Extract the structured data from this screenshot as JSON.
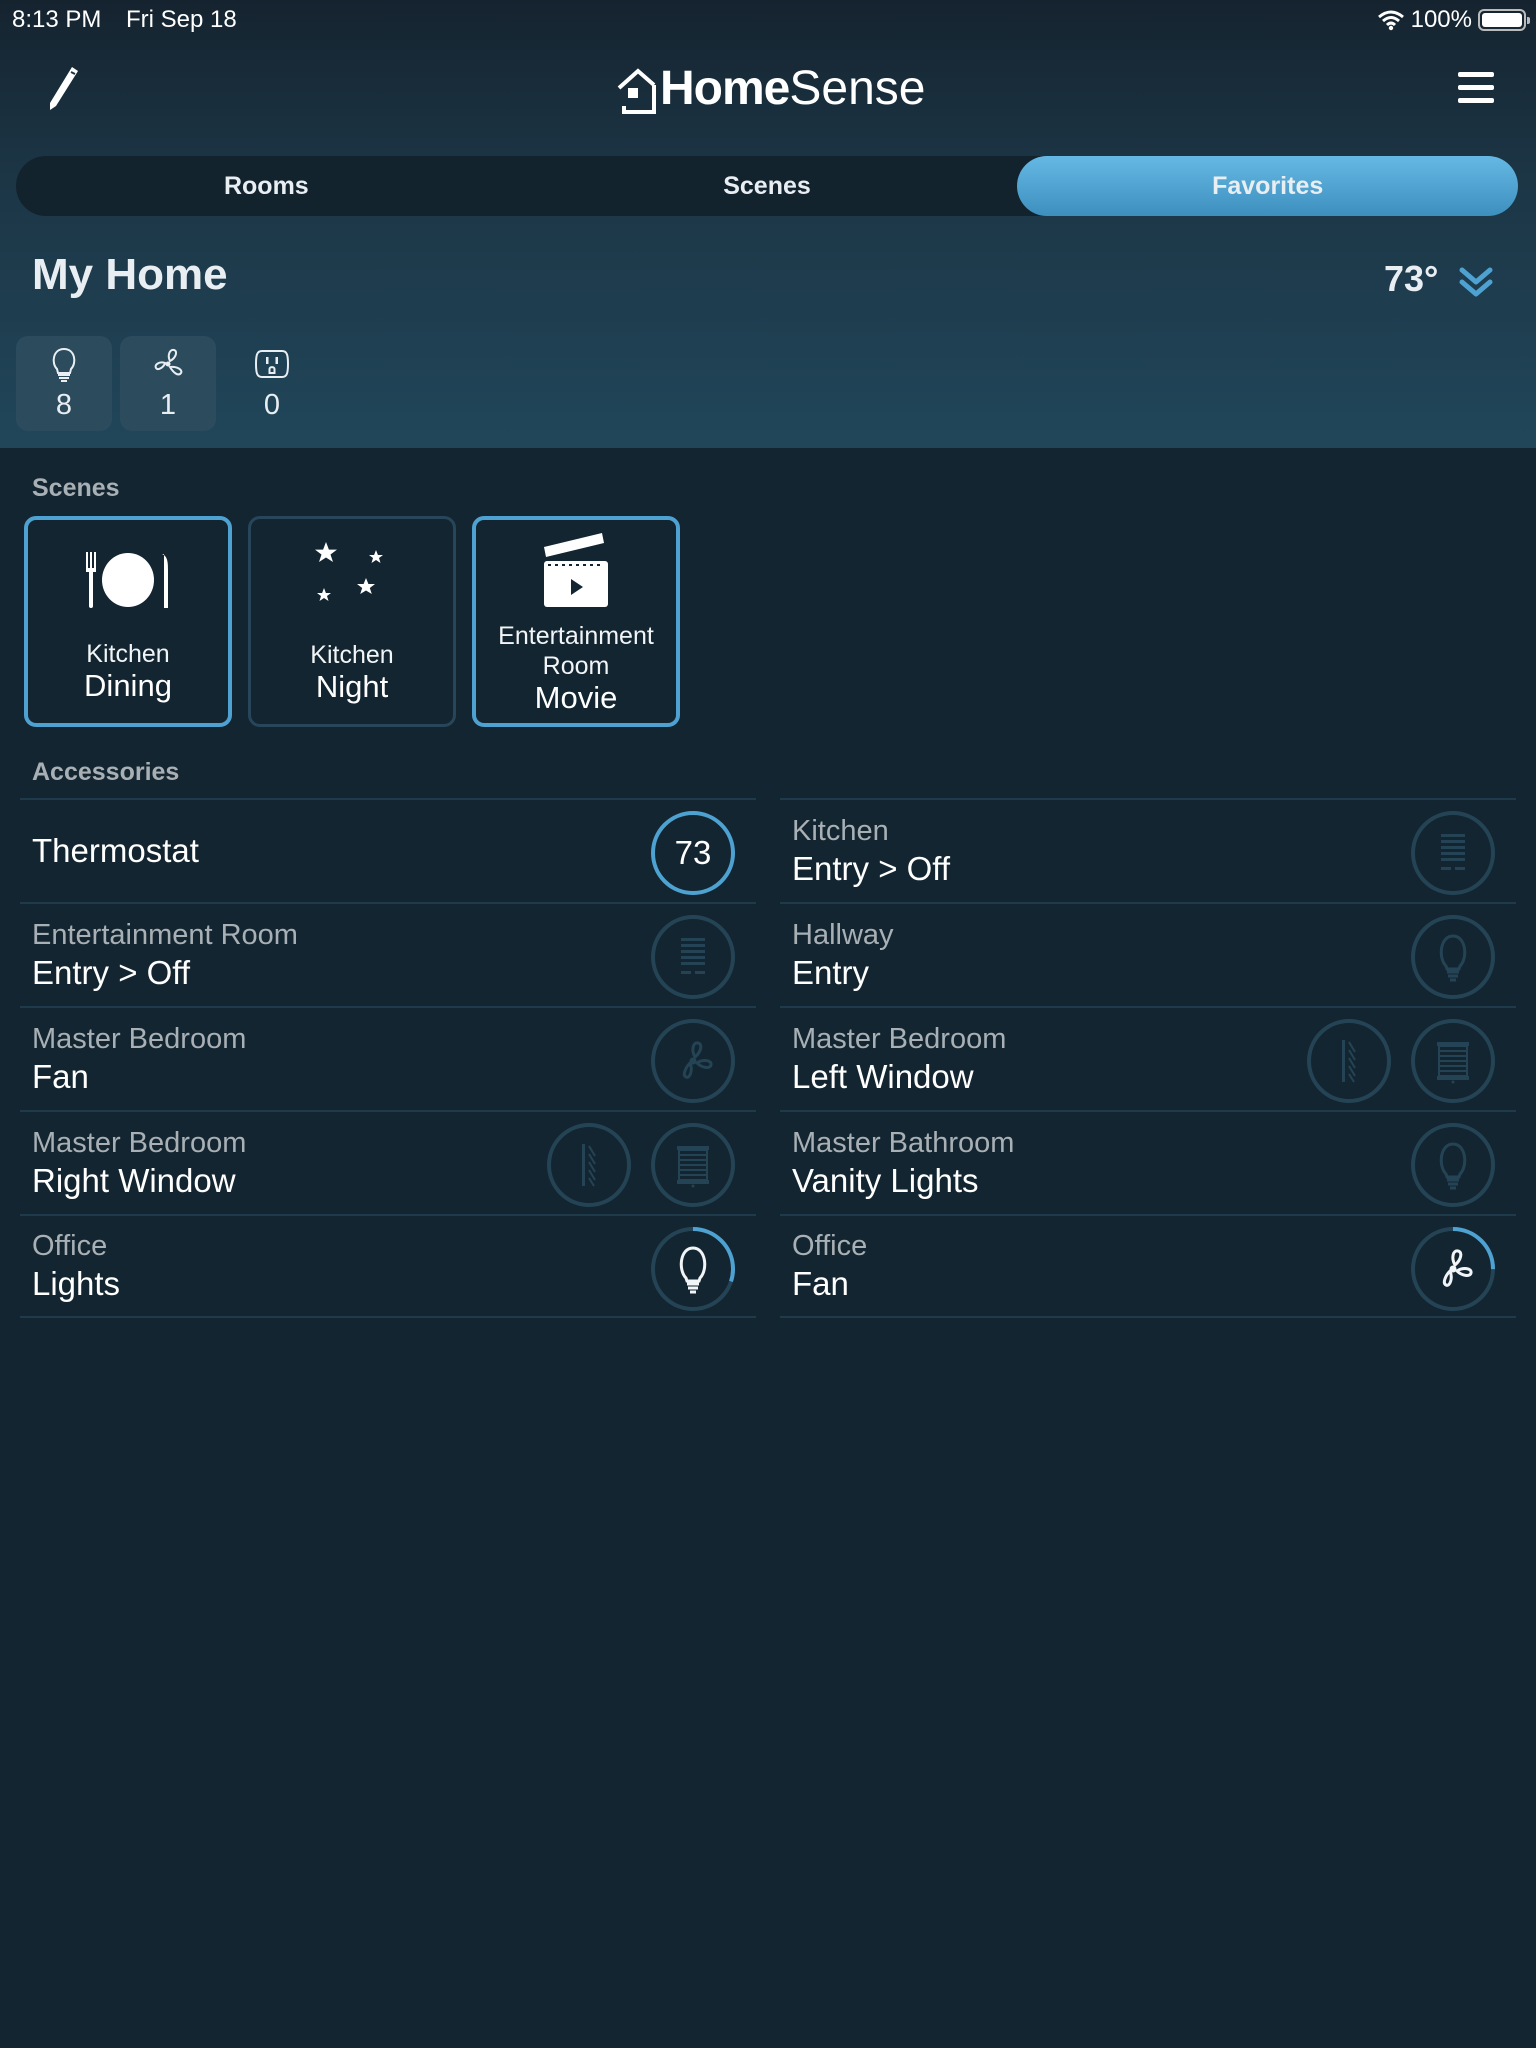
{
  "status_bar": {
    "time": "8:13 PM",
    "date": "Fri Sep 18",
    "battery": "100%"
  },
  "header": {
    "app_name_bold": "Home",
    "app_name_light": "Sense"
  },
  "tabs": [
    {
      "label": "Rooms",
      "active": false
    },
    {
      "label": "Scenes",
      "active": false
    },
    {
      "label": "Favorites",
      "active": true
    }
  ],
  "home": {
    "title": "My Home",
    "temperature": "73°"
  },
  "counts": [
    {
      "icon": "lightbulb-icon",
      "value": "8"
    },
    {
      "icon": "fan-icon",
      "value": "1"
    },
    {
      "icon": "outlet-icon",
      "value": "0"
    }
  ],
  "sections": {
    "scenes": "Scenes",
    "accessories": "Accessories"
  },
  "scenes": [
    {
      "room": "Kitchen",
      "name": "Dining",
      "icon": "dining-icon",
      "active": true
    },
    {
      "room": "Kitchen",
      "name": "Night",
      "icon": "stars-icon",
      "active": false
    },
    {
      "room": "Entertainment Room",
      "name": "Movie",
      "icon": "clapperboard-icon",
      "active": true
    }
  ],
  "accessories": [
    {
      "room": "",
      "name": "Thermostat",
      "controls": [
        {
          "type": "thermostat",
          "value": "73",
          "level": 1.0,
          "state": "on"
        }
      ]
    },
    {
      "room": "Kitchen",
      "name": "Entry > Off",
      "controls": [
        {
          "type": "keypad",
          "state": "off"
        }
      ]
    },
    {
      "room": "Entertainment Room",
      "name": "Entry > Off",
      "controls": [
        {
          "type": "keypad",
          "state": "off"
        }
      ]
    },
    {
      "room": "Hallway",
      "name": "Entry",
      "controls": [
        {
          "type": "light",
          "state": "off"
        }
      ]
    },
    {
      "room": "Master Bedroom",
      "name": "Fan",
      "controls": [
        {
          "type": "fan",
          "state": "off"
        }
      ]
    },
    {
      "room": "Master Bedroom",
      "name": "Left Window",
      "controls": [
        {
          "type": "sheer",
          "state": "off"
        },
        {
          "type": "shade",
          "state": "off"
        }
      ]
    },
    {
      "room": "Master Bedroom",
      "name": "Right Window",
      "controls": [
        {
          "type": "sheer",
          "state": "off"
        },
        {
          "type": "shade",
          "state": "off"
        }
      ]
    },
    {
      "room": "Master Bathroom",
      "name": "Vanity Lights",
      "controls": [
        {
          "type": "light",
          "state": "off"
        }
      ]
    },
    {
      "room": "Office",
      "name": "Lights",
      "controls": [
        {
          "type": "light",
          "state": "on",
          "level": 0.3
        }
      ]
    },
    {
      "room": "Office",
      "name": "Fan",
      "controls": [
        {
          "type": "fan",
          "state": "on",
          "level": 0.25
        }
      ]
    }
  ],
  "colors": {
    "accent": "#4ea2d2",
    "ring_off": "#244456",
    "background": "#132530"
  }
}
